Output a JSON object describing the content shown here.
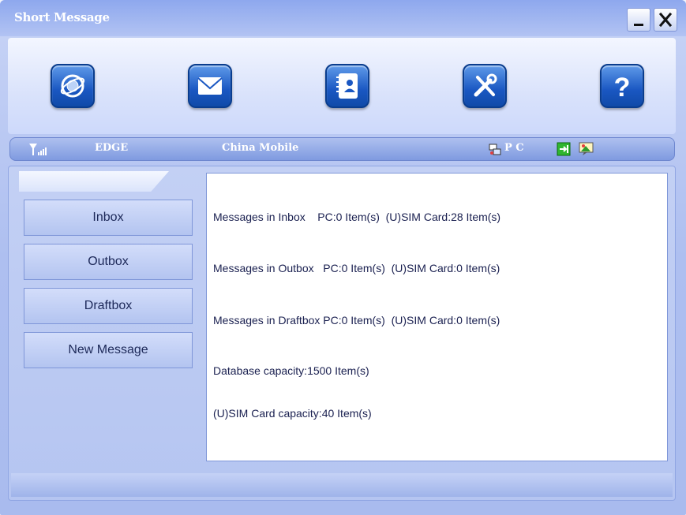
{
  "window": {
    "title": "Short Message"
  },
  "controls": {
    "minimize": "minimize-icon",
    "close": "close-icon"
  },
  "toolbar": {
    "items": [
      {
        "icon": "network-globe-icon"
      },
      {
        "icon": "envelope-icon"
      },
      {
        "icon": "contacts-book-icon"
      },
      {
        "icon": "tools-icon"
      },
      {
        "icon": "help-icon"
      }
    ]
  },
  "status": {
    "network": "EDGE",
    "operator": "China Mobile",
    "storage": "P C"
  },
  "nav": {
    "inbox": "Inbox",
    "outbox": "Outbox",
    "draftbox": "Draftbox",
    "new_message": "New Message"
  },
  "summary": {
    "inbox": "Messages in Inbox    PC:0 Item(s)  (U)SIM Card:28 Item(s)",
    "outbox": "Messages in Outbox   PC:0 Item(s)  (U)SIM Card:0 Item(s)",
    "draftbox": "Messages in Draftbox PC:0 Item(s)  (U)SIM Card:0 Item(s)",
    "db_capacity": "Database capacity:1500 Item(s)",
    "sim_capacity": "(U)SIM Card capacity:40 Item(s)"
  },
  "colors": {
    "accent": "#1a57c2",
    "panel": "#b5c5f1",
    "text": "#1a2050"
  }
}
